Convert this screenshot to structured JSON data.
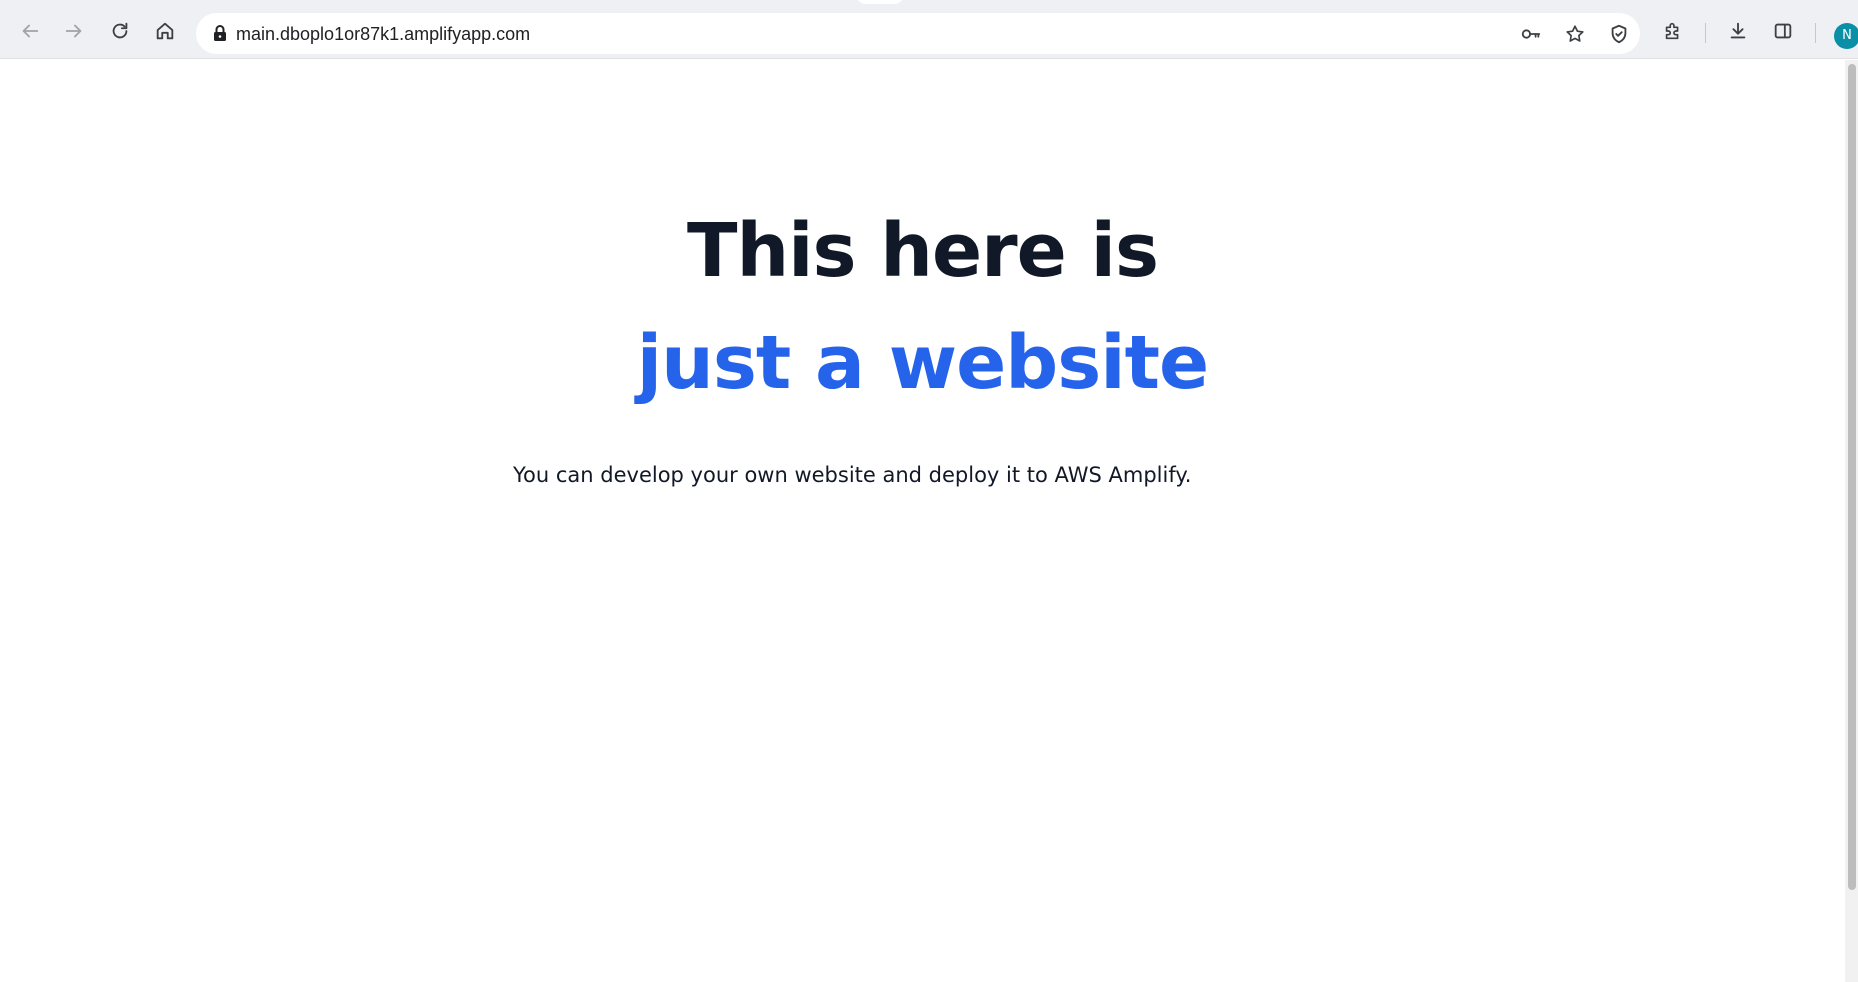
{
  "browser": {
    "url": "main.dboplo1or87k1.amplifyapp.com",
    "profile_initial": "N",
    "icons": {
      "back": "back-arrow-icon",
      "forward": "forward-arrow-icon",
      "reload": "reload-icon",
      "home": "home-icon",
      "lock": "lock-icon",
      "password": "key-icon",
      "bookmark": "star-icon",
      "shield": "shield-icon",
      "extensions": "puzzle-icon",
      "downloads": "download-icon",
      "side_panel": "side-panel-icon"
    },
    "colors": {
      "toolbar": "#eef0f4",
      "avatar": "#0b8fa6"
    }
  },
  "page": {
    "heading_line1": "This here is",
    "heading_line2": "just a website",
    "subtitle": "You can develop your own website and deploy it to AWS Amplify.",
    "colors": {
      "heading": "#111827",
      "accent": "#2563eb"
    }
  }
}
